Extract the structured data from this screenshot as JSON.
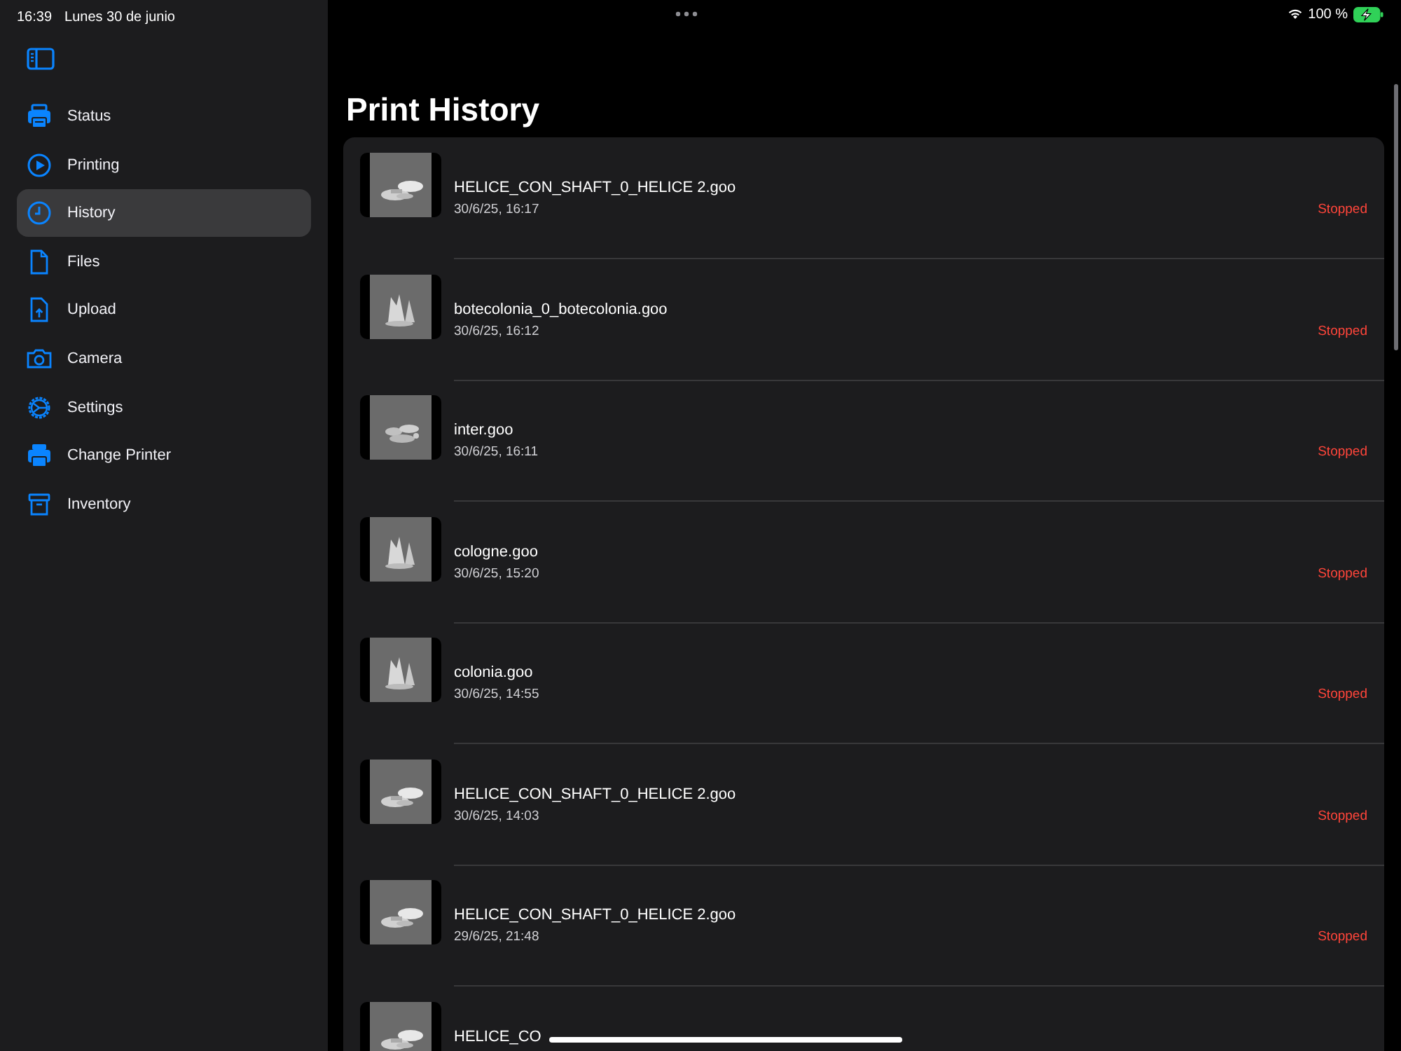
{
  "status_bar": {
    "time": "16:39",
    "date": "Lunes 30 de junio",
    "battery": "100 %"
  },
  "sidebar": {
    "items": [
      {
        "label": "Status",
        "selected": false
      },
      {
        "label": "Printing",
        "selected": false
      },
      {
        "label": "History",
        "selected": true
      },
      {
        "label": "Files",
        "selected": false
      },
      {
        "label": "Upload",
        "selected": false
      },
      {
        "label": "Camera",
        "selected": false
      },
      {
        "label": "Settings",
        "selected": false
      },
      {
        "label": "Change Printer",
        "selected": false
      },
      {
        "label": "Inventory",
        "selected": false
      }
    ]
  },
  "title": "Print History",
  "history": [
    {
      "name": "HELICE_CON_SHAFT_0_HELICE 2.goo",
      "date": "30/6/25, 16:17",
      "status": "Stopped"
    },
    {
      "name": "botecolonia_0_botecolonia.goo",
      "date": "30/6/25, 16:12",
      "status": "Stopped"
    },
    {
      "name": "inter.goo",
      "date": "30/6/25, 16:11",
      "status": "Stopped"
    },
    {
      "name": "cologne.goo",
      "date": "30/6/25, 15:20",
      "status": "Stopped"
    },
    {
      "name": "colonia.goo",
      "date": "30/6/25, 14:55",
      "status": "Stopped"
    },
    {
      "name": "HELICE_CON_SHAFT_0_HELICE 2.goo",
      "date": "30/6/25, 14:03",
      "status": "Stopped"
    },
    {
      "name": "HELICE_CON_SHAFT_0_HELICE 2.goo",
      "date": "29/6/25, 21:48",
      "status": "Stopped"
    },
    {
      "name": "HELICE_CO"
    }
  ]
}
